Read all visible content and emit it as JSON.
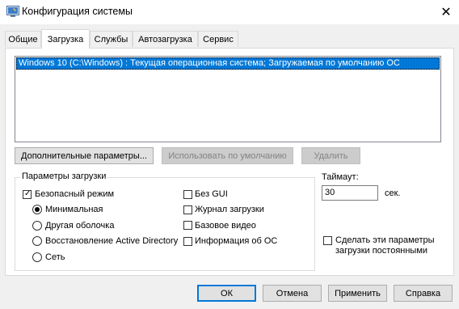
{
  "window": {
    "title": "Конфигурация системы",
    "close_glyph": "✕"
  },
  "tabs": [
    {
      "label": "Общие"
    },
    {
      "label": "Загрузка"
    },
    {
      "label": "Службы"
    },
    {
      "label": "Автозагрузка"
    },
    {
      "label": "Сервис"
    }
  ],
  "active_tab": "Загрузка",
  "os_list": {
    "items": [
      "Windows 10 (C:\\Windows) : Текущая операционная система; Загружаемая по умолчанию ОС"
    ]
  },
  "os_buttons": {
    "advanced": "Дополнительные параметры...",
    "set_default": "Использовать по умолчанию",
    "delete": "Удалить"
  },
  "boot_options": {
    "group_label": "Параметры загрузки",
    "safe_boot": {
      "label": "Безопасный режим",
      "checked": true
    },
    "radios": [
      {
        "label": "Минимальная",
        "selected": true
      },
      {
        "label": "Другая оболочка",
        "selected": false
      },
      {
        "label": "Восстановление Active Directory",
        "selected": false
      },
      {
        "label": "Сеть",
        "selected": false
      }
    ],
    "checkboxes": [
      {
        "label": "Без GUI",
        "checked": false
      },
      {
        "label": "Журнал загрузки",
        "checked": false
      },
      {
        "label": "Базовое видео",
        "checked": false
      },
      {
        "label": "Информация  об ОС",
        "checked": false
      }
    ]
  },
  "timeout": {
    "label": "Таймаут:",
    "value": "30",
    "unit": "сек."
  },
  "permanent": {
    "label_line1": "Сделать эти параметры",
    "label_line2": "загрузки постоянными",
    "checked": false
  },
  "dialog_buttons": {
    "ok": "ОК",
    "cancel": "Отмена",
    "apply": "Применить",
    "help": "Справка"
  },
  "colors": {
    "selection": "#0078d7",
    "background": "#f0f0f0",
    "panel": "#ffffff"
  }
}
